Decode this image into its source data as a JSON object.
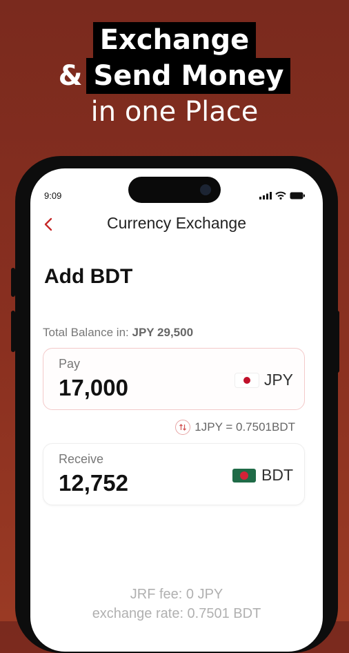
{
  "headline": {
    "line1": "Exchange",
    "amp": "&",
    "line2": "Send Money",
    "line3": "in one Place"
  },
  "status_bar": {
    "time": "9:09"
  },
  "nav": {
    "title": "Currency Exchange"
  },
  "page": {
    "title": "Add BDT"
  },
  "balance": {
    "label": "Total Balance in:",
    "value": "JPY 29,500"
  },
  "pay": {
    "label": "Pay",
    "amount": "17,000",
    "currency": "JPY"
  },
  "rate": {
    "text": "1JPY = 0.7501BDT"
  },
  "receive": {
    "label": "Receive",
    "amount": "12,752",
    "currency": "BDT"
  },
  "footer": {
    "fee": "JRF fee: 0 JPY",
    "exchange_rate": "exchange rate: 0.7501 BDT"
  },
  "colors": {
    "background": "#8a3020",
    "accent": "#c62828",
    "pay_border": "#f3c9c9"
  }
}
